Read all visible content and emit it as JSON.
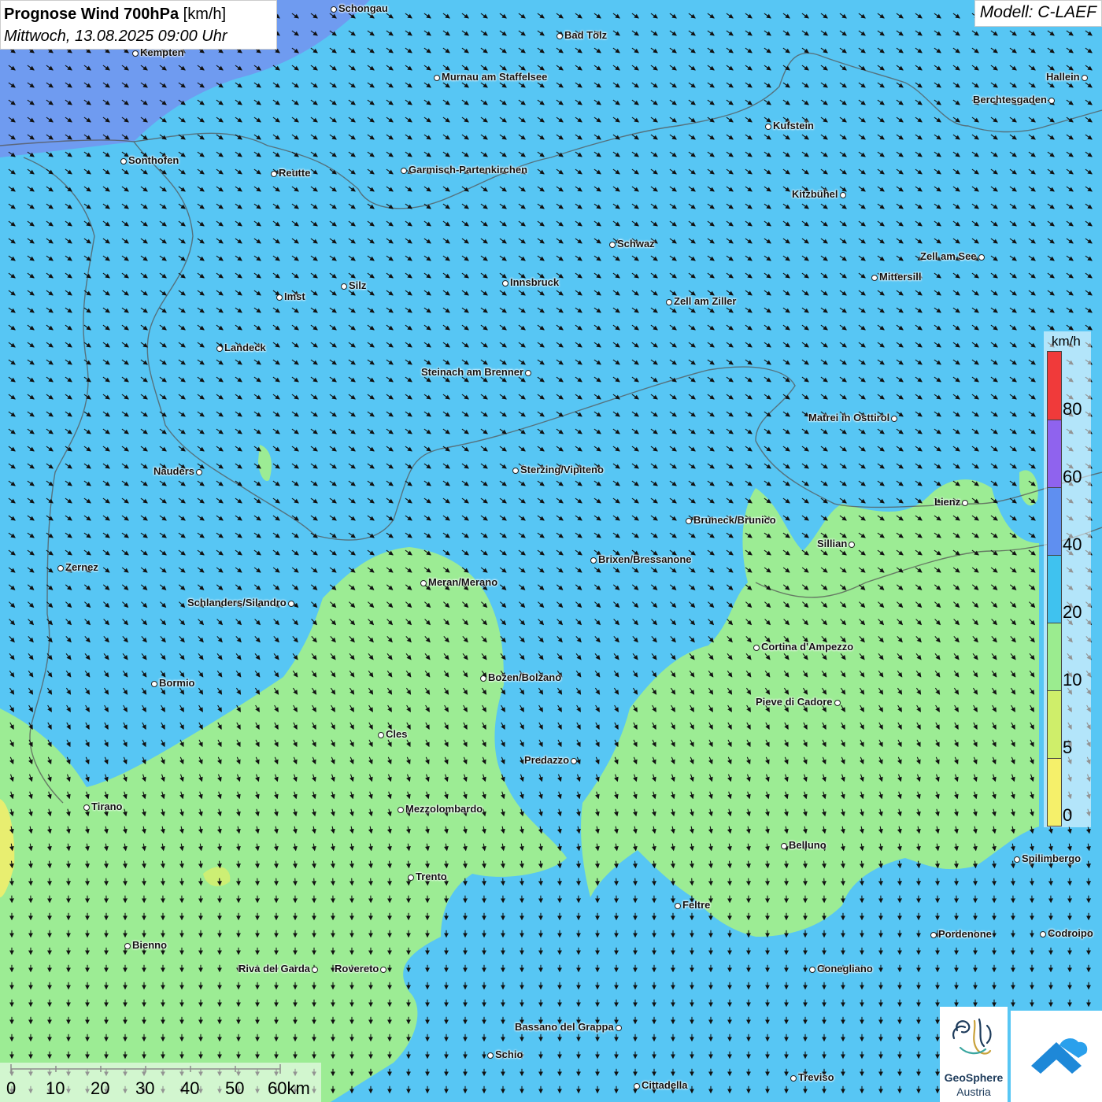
{
  "header": {
    "title_bold": "Prognose Wind 700hPa",
    "title_unit": "[km/h]",
    "subtitle": "Mittwoch, 13.08.2025 09:00 Uhr",
    "model": "Modell: C-LAEF"
  },
  "legend": {
    "unit": "km/h",
    "ticks": [
      "80",
      "60",
      "40",
      "20",
      "10",
      "5",
      "0"
    ],
    "colors": {
      "0-5": "#f5f06a",
      "5-10": "#cfee6a",
      "10-20": "#9bec8f",
      "20-40": "#3fc2ef",
      "40-60": "#5f8ff0",
      "60-80": "#8f63ee",
      "80+": "#f03a3a"
    }
  },
  "scalebar": {
    "labels": [
      "0",
      "10",
      "20",
      "30",
      "40",
      "50",
      "60km"
    ]
  },
  "logos": {
    "geosphere_line1": "GeoSphere",
    "geosphere_line2": "Austria"
  },
  "cities": [
    {
      "name": "Schongau"
    },
    {
      "name": "Bad Tölz"
    },
    {
      "name": "Kempten"
    },
    {
      "name": "Murnau am Staffelsee"
    },
    {
      "name": "Hallein"
    },
    {
      "name": "Berchtesgaden"
    },
    {
      "name": "Kufstein"
    },
    {
      "name": "Sonthofen"
    },
    {
      "name": "Reutte"
    },
    {
      "name": "Garmisch-Partenkirchen"
    },
    {
      "name": "Kitzbühel"
    },
    {
      "name": "Schwaz"
    },
    {
      "name": "Zell am See"
    },
    {
      "name": "Mittersill"
    },
    {
      "name": "Innsbruck"
    },
    {
      "name": "Silz"
    },
    {
      "name": "Imst"
    },
    {
      "name": "Zell am Ziller"
    },
    {
      "name": "Landeck"
    },
    {
      "name": "Steinach am Brenner"
    },
    {
      "name": "Matrei in Osttirol"
    },
    {
      "name": "Nauders"
    },
    {
      "name": "Sterzing/Vipiteno"
    },
    {
      "name": "Lienz"
    },
    {
      "name": "Bruneck/Brunico"
    },
    {
      "name": "Sillian"
    },
    {
      "name": "Brixen/Bressanone"
    },
    {
      "name": "Zernez"
    },
    {
      "name": "Meran/Merano"
    },
    {
      "name": "Schlanders/Silandro"
    },
    {
      "name": "Cortina d'Ampezzo"
    },
    {
      "name": "Bozen/Bolzano"
    },
    {
      "name": "Bormio"
    },
    {
      "name": "Pieve di Cadore"
    },
    {
      "name": "Cles"
    },
    {
      "name": "Predazzo"
    },
    {
      "name": "Tirano"
    },
    {
      "name": "Mezzolombardo"
    },
    {
      "name": "Belluno"
    },
    {
      "name": "Spilimbergo"
    },
    {
      "name": "Trento"
    },
    {
      "name": "Feltre"
    },
    {
      "name": "Bienno"
    },
    {
      "name": "Pordenone"
    },
    {
      "name": "Codroipo"
    },
    {
      "name": "Riva del Garda"
    },
    {
      "name": "Rovereto"
    },
    {
      "name": "Conegliano"
    },
    {
      "name": "Bassano del Grappa"
    },
    {
      "name": "Schio"
    },
    {
      "name": "Treviso"
    },
    {
      "name": "Cittadella"
    }
  ]
}
